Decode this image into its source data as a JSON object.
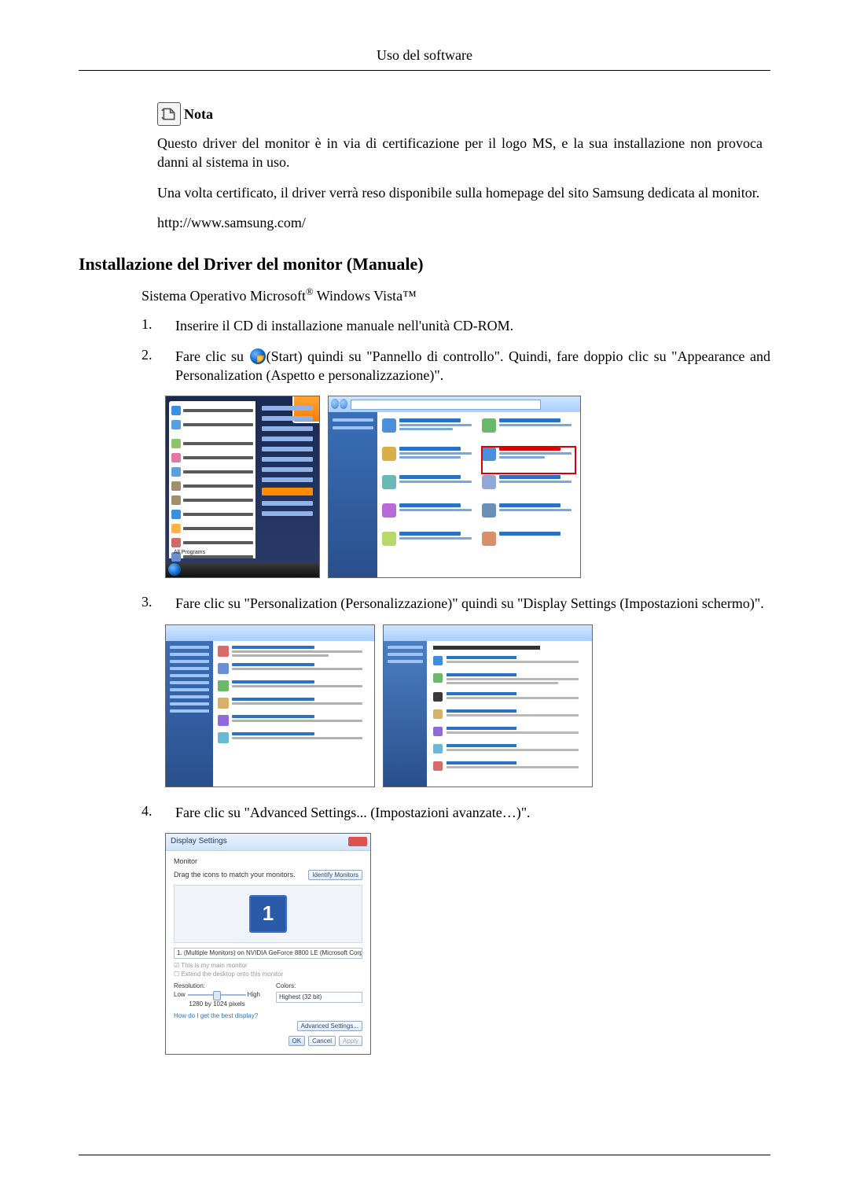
{
  "header": {
    "title": "Uso del software"
  },
  "note": {
    "label": "Nota",
    "p1": "Questo driver del monitor è in via di certificazione per il logo MS, e la sua installazione non provoca danni al sistema in uso.",
    "p2": "Una volta certificato, il driver verrà reso disponibile sulla homepage del sito Samsung dedicata al monitor.",
    "p3": "http://www.samsung.com/"
  },
  "section": {
    "title": "Installazione del Driver del monitor (Manuale)",
    "intro_prefix": "Sistema Operativo Microsoft",
    "intro_suffix": " Windows Vista™"
  },
  "steps": {
    "s1": {
      "num": "1.",
      "text": "Inserire il CD di installazione manuale nell'unità CD-ROM."
    },
    "s2": {
      "num": "2.",
      "pre": "Fare clic su ",
      "post": "(Start) quindi su \"Pannello di controllo\". Quindi, fare doppio clic su \"Appearance and Personalization (Aspetto e personalizzazione)\"."
    },
    "s3": {
      "num": "3.",
      "text": "Fare clic su \"Personalization (Personalizzazione)\" quindi su \"Display Settings (Impostazioni schermo)\"."
    },
    "s4": {
      "num": "4.",
      "text": "Fare clic su \"Advanced Settings... (Impostazioni avanzate…)\"."
    }
  },
  "start_menu": {
    "all_programs": "All Programs"
  },
  "display_settings": {
    "title": "Display Settings",
    "tab": "Monitor",
    "drag_text": "Drag the icons to match your monitors.",
    "identify_btn": "Identify Monitors",
    "monitor_num": "1",
    "device_line": "1. (Multiple Monitors) on NVIDIA GeForce 8800 LE (Microsoft Corporation - …",
    "chk1": "☑ This is my main monitor",
    "chk2": "☐ Extend the desktop onto this monitor",
    "res_label": "Resolution:",
    "low": "Low",
    "high": "High",
    "res_value": "1280 by 1024 pixels",
    "colors_label": "Colors:",
    "colors_value": "Highest (32 bit)",
    "help_link": "How do I get the best display?",
    "adv_btn": "Advanced Settings...",
    "ok": "OK",
    "cancel": "Cancel",
    "apply": "Apply"
  }
}
